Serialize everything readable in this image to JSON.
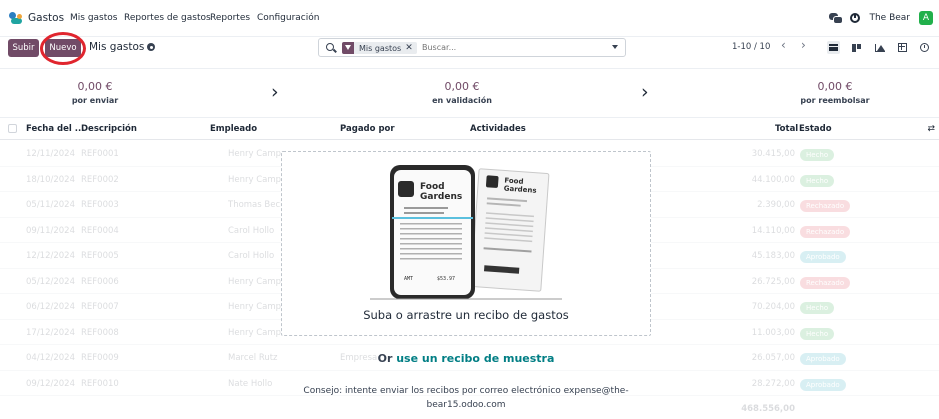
{
  "nav": {
    "app_name": "Gastos",
    "items": [
      "Mis gastos",
      "Reportes de gastos",
      "Reportes",
      "Configuración"
    ],
    "user_name": "The Bear",
    "avatar_letter": "A"
  },
  "control": {
    "upload_label": "Subir",
    "new_label": "Nuevo",
    "breadcrumb": "Mis gastos",
    "search": {
      "facet": "Mis gastos",
      "facet_close": "✕",
      "placeholder": "Buscar..."
    },
    "pager": "1-10 / 10",
    "prev": "‹",
    "next": "›"
  },
  "summary": [
    {
      "value": "0,00 €",
      "label": "por enviar"
    },
    {
      "value": "0,00 €",
      "label": "en validación"
    },
    {
      "value": "0,00 €",
      "label": "por reembolsar"
    }
  ],
  "table": {
    "headers": {
      "date": "Fecha del ...",
      "description": "Descripción",
      "employee": "Empleado",
      "paid_by": "Pagado por",
      "activities": "Actividades",
      "total": "Total",
      "state": "Estado"
    },
    "rows": [
      {
        "date": "12/11/2024",
        "desc": "REF0001",
        "employee": "Henry Campos",
        "paid_by": "",
        "amount": "30.415,00",
        "badge_color": "#28a745",
        "badge": "Hecho"
      },
      {
        "date": "18/10/2024",
        "desc": "REF0002",
        "employee": "Henry Campos",
        "paid_by": "",
        "amount": "44.100,00",
        "badge_color": "#28a745",
        "badge": "Hecho"
      },
      {
        "date": "05/11/2024",
        "desc": "REF0003",
        "employee": "Thomas Beck",
        "paid_by": "",
        "amount": "2.390,00",
        "badge_color": "#dc3545",
        "badge": "Rechazado"
      },
      {
        "date": "09/11/2024",
        "desc": "REF0004",
        "employee": "Carol Hollo",
        "paid_by": "",
        "amount": "14.110,00",
        "badge_color": "#dc3545",
        "badge": "Rechazado"
      },
      {
        "date": "12/12/2024",
        "desc": "REF0005",
        "employee": "Carol Hollo",
        "paid_by": "",
        "amount": "45.183,00",
        "badge_color": "#17a2b8",
        "badge": "Aprobado"
      },
      {
        "date": "05/12/2024",
        "desc": "REF0006",
        "employee": "Henry Campos",
        "paid_by": "",
        "amount": "26.725,00",
        "badge_color": "#dc3545",
        "badge": "Rechazado"
      },
      {
        "date": "06/12/2024",
        "desc": "REF0007",
        "employee": "Henry Campos",
        "paid_by": "",
        "amount": "70.204,00",
        "badge_color": "#28a745",
        "badge": "Hecho"
      },
      {
        "date": "17/12/2024",
        "desc": "REF0008",
        "employee": "Henry Campos",
        "paid_by": "",
        "amount": "11.003,00",
        "badge_color": "#28a745",
        "badge": "Hecho"
      },
      {
        "date": "04/12/2024",
        "desc": "REF0009",
        "employee": "Marcel Rutz",
        "paid_by": "Empresa",
        "amount": "26.057,00",
        "badge_color": "#17a2b8",
        "badge": "Aprobado"
      },
      {
        "date": "09/12/2024",
        "desc": "REF0010",
        "employee": "Nate Hollo",
        "paid_by": "",
        "amount": "28.272,00",
        "badge_color": "#17a2b8",
        "badge": "Aprobado"
      }
    ],
    "grand_total": "468.556,00"
  },
  "dropzone": {
    "title": "Suba o arrastre un recibo de gastos",
    "or_prefix": "Or",
    "sample_link": "use un recibo de muestra",
    "tip_line1": "Consejo: intente enviar los recibos por correo electrónico expense@the-",
    "tip_line2": "bear15.odoo.com"
  },
  "illustration": {
    "brand_line1": "Food",
    "brand_line2": "Gardens",
    "amount": "$53.97",
    "amount_label": "AMT"
  },
  "colors": {
    "primary": "#714b67",
    "highlight_circle": "#e0252e",
    "link": "#017e84",
    "avatar_bg": "#21b04b"
  }
}
